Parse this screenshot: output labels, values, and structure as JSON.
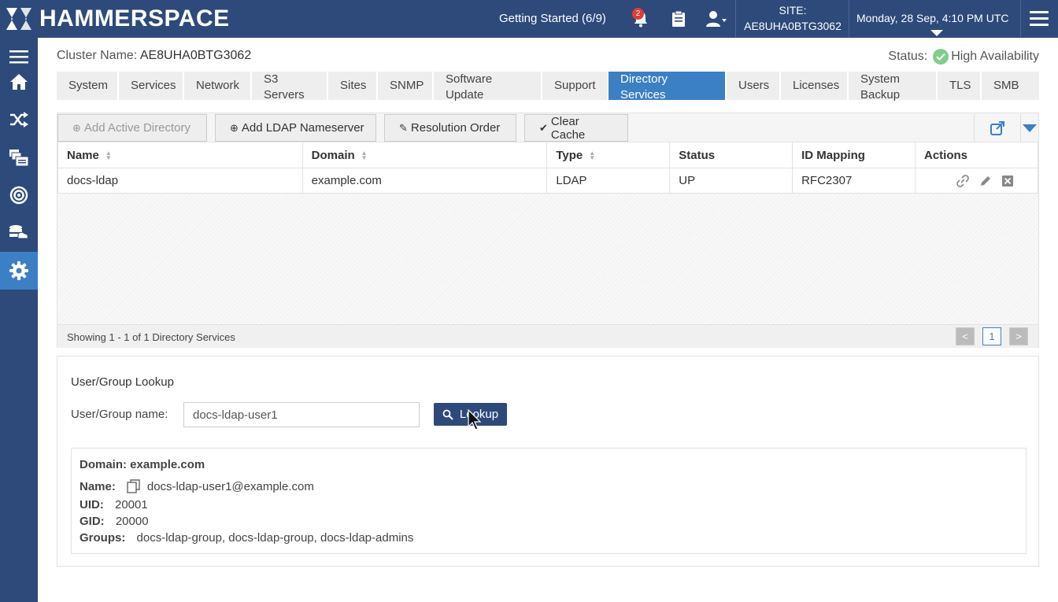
{
  "brand": {
    "name": "HAMMERSPACE"
  },
  "topbar": {
    "getting_started": "Getting Started (6/9)",
    "notification_count": "2",
    "site_label": "SITE:",
    "site_id": "AE8UHA0BTG3062",
    "datetime": "Monday, 28 Sep, 4:10 PM UTC"
  },
  "sidebar": {
    "items": [
      "menu-icon",
      "home-icon",
      "shuffle-icon",
      "shares-icon",
      "target-icon",
      "storage-icon",
      "gear-icon"
    ],
    "active_index": 6
  },
  "header": {
    "cluster_label": "Cluster Name:",
    "cluster_name": "AE8UHA0BTG3062",
    "status_label": "Status:",
    "status_value": "High Availability"
  },
  "tabs": [
    {
      "line1": "System",
      "line2": ""
    },
    {
      "line1": "Services",
      "line2": ""
    },
    {
      "line1": "Network",
      "line2": ""
    },
    {
      "line1": "S3",
      "line2": "Servers"
    },
    {
      "line1": "Sites",
      "line2": ""
    },
    {
      "line1": "SNMP",
      "line2": ""
    },
    {
      "line1": "Software",
      "line2": "Update"
    },
    {
      "line1": "Support",
      "line2": ""
    },
    {
      "line1": "Directory",
      "line2": "Services"
    },
    {
      "line1": "Users",
      "line2": ""
    },
    {
      "line1": "Licenses",
      "line2": ""
    },
    {
      "line1": "System",
      "line2": "Backup"
    },
    {
      "line1": "TLS",
      "line2": ""
    },
    {
      "line1": "SMB",
      "line2": ""
    }
  ],
  "active_tab": 8,
  "toolbar": {
    "add_ad": "Add Active Directory",
    "add_ldap": "Add LDAP Nameserver",
    "resolution_order": "Resolution Order",
    "clear_cache": "Clear Cache"
  },
  "table": {
    "headers": [
      "Name",
      "Domain",
      "Type",
      "Status",
      "ID Mapping",
      "Actions"
    ],
    "rows": [
      {
        "name": "docs-ldap",
        "domain": "example.com",
        "type": "LDAP",
        "status": "UP",
        "id_mapping": "RFC2307"
      }
    ],
    "footer": "Showing 1 - 1 of 1 Directory Services",
    "page_prev": "<",
    "page_current": "1",
    "page_next": ">"
  },
  "lookup": {
    "title": "User/Group Lookup",
    "label": "User/Group name:",
    "value": "docs-ldap-user1",
    "button": "Lookup",
    "result": {
      "domain_label": "Domain:",
      "domain": "example.com",
      "name_label": "Name:",
      "name": "docs-ldap-user1@example.com",
      "uid_label": "UID:",
      "uid": "20001",
      "gid_label": "GID:",
      "gid": "20000",
      "groups_label": "Groups:",
      "groups": "docs-ldap-group, docs-ldap-group, docs-ldap-admins"
    }
  },
  "colors": {
    "navy": "#2d4a7a",
    "accent": "#3b7fc4",
    "ok": "#7fcf8a",
    "alert": "#e53935"
  }
}
